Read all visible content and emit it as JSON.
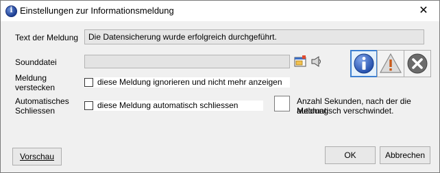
{
  "window": {
    "title": "Einstellungen zur Informationsmeldung",
    "close_glyph": "✕"
  },
  "message_text": {
    "label": "Text der Meldung",
    "value": "Die Datensicherung wurde erfolgreich durchgeführt."
  },
  "sound_file": {
    "label": "Sounddatei",
    "value": "",
    "browse_icon": "folder-browse-icon",
    "play_icon": "speaker-icon"
  },
  "hide_message": {
    "label_line1": "Meldung",
    "label_line2": "verstecken",
    "checkbox_label": "diese Meldung ignorieren und nicht mehr anzeigen",
    "checked": false
  },
  "auto_close": {
    "label_line1": "Automatisches",
    "label_line2": "Schliessen",
    "checkbox_label": "diese Meldung automatisch schliessen",
    "checked": false,
    "seconds_value": "",
    "seconds_hint_line1": "Anzahl Sekunden, nach der die Meldung",
    "seconds_hint_line2": "automatisch verschwindet."
  },
  "message_type_icons": [
    {
      "name": "info-icon",
      "selected": true
    },
    {
      "name": "warning-icon",
      "selected": false
    },
    {
      "name": "error-icon",
      "selected": false
    }
  ],
  "buttons": {
    "preview": "Vorschau",
    "ok": "OK",
    "cancel": "Abbrechen"
  },
  "colors": {
    "selection_border": "#3c7fd1",
    "info_blue": "#1e4aa8",
    "error_gray": "#6b6b6b"
  }
}
